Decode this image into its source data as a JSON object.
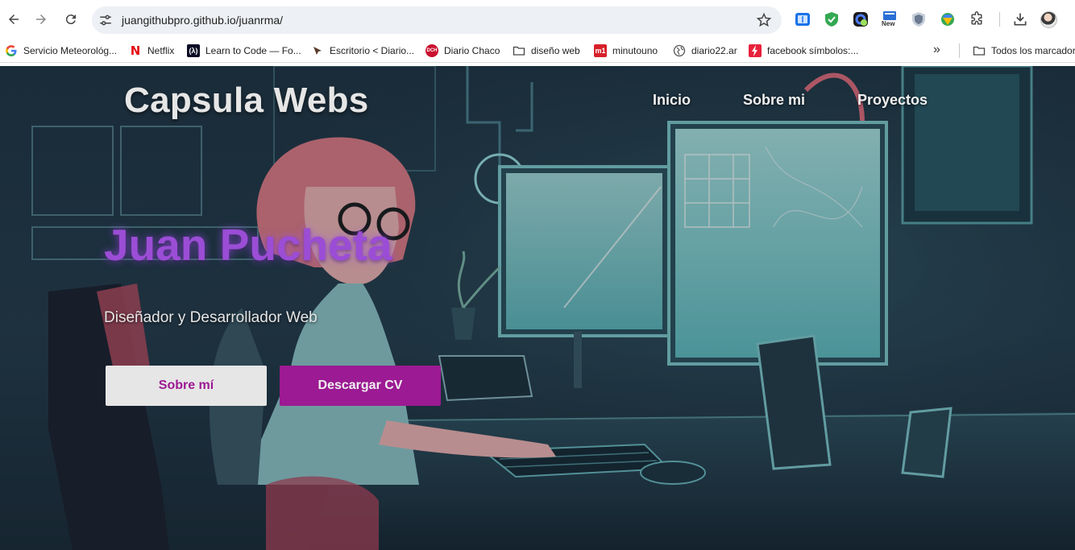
{
  "browser": {
    "url": "juangithubpro.github.io/juanrma/",
    "new_badge": "New",
    "colors": {
      "toolbar_bg": "#ffffff",
      "omnibox_bg": "#edf0f4"
    }
  },
  "bookmarks": {
    "items": [
      {
        "label": "Servicio Meteorológ...",
        "icon": "google-icon"
      },
      {
        "label": "Netflix",
        "icon": "netflix-icon"
      },
      {
        "label": "Learn to Code — Fo...",
        "icon": "freecodecamp-icon"
      },
      {
        "label": "Escritorio < Diario...",
        "icon": "site-icon"
      },
      {
        "label": "Diario Chaco",
        "icon": "diario-chaco-icon",
        "icon_text": "DCH"
      },
      {
        "label": "diseño web",
        "icon": "folder-icon"
      },
      {
        "label": "minutouno",
        "icon": "minutouno-icon",
        "icon_text": "m1"
      },
      {
        "label": "diario22.ar",
        "icon": "globe-icon"
      },
      {
        "label": "facebook símbolos:...",
        "icon": "bolt-icon"
      }
    ],
    "all_bookmarks": "Todos los marcadores"
  },
  "site": {
    "brand": "Capsula Webs",
    "nav": [
      "Inicio",
      "Sobre mi",
      "Proyectos"
    ],
    "hero_name": "Juan Pucheta",
    "hero_subtitle": "Diseñador y Desarrollador Web",
    "button_primary": "Sobre mí",
    "button_secondary": "Descargar CV",
    "colors": {
      "accent": "#9c1a93",
      "name": "#9b4dd6",
      "light_button": "#e6e6e6"
    }
  }
}
